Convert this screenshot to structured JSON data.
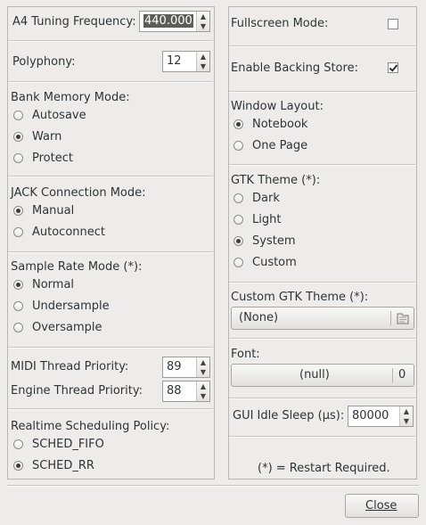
{
  "left": {
    "a4": {
      "label": "A4 Tuning Frequency:",
      "value": "440.000"
    },
    "polyphony": {
      "label": "Polyphony:",
      "value": "12"
    },
    "bank_memory": {
      "title": "Bank Memory Mode:",
      "options": [
        "Autosave",
        "Warn",
        "Protect"
      ],
      "selected": "Warn"
    },
    "jack": {
      "title": "JACK Connection Mode:",
      "options": [
        "Manual",
        "Autoconnect"
      ],
      "selected": "Manual"
    },
    "sample_rate": {
      "title": "Sample Rate Mode (*):",
      "options": [
        "Normal",
        "Undersample",
        "Oversample"
      ],
      "selected": "Normal"
    },
    "midi_priority": {
      "label": "MIDI Thread Priority:",
      "value": "89"
    },
    "engine_priority": {
      "label": "Engine Thread Priority:",
      "value": "88"
    },
    "realtime": {
      "title": "Realtime Scheduling Policy:",
      "options": [
        "SCHED_FIFO",
        "SCHED_RR"
      ],
      "selected": "SCHED_RR"
    }
  },
  "right": {
    "fullscreen": {
      "label": "Fullscreen Mode:",
      "checked": false
    },
    "backing_store": {
      "label": "Enable Backing Store:",
      "checked": true
    },
    "window_layout": {
      "title": "Window Layout:",
      "options": [
        "Notebook",
        "One Page"
      ],
      "selected": "Notebook"
    },
    "gtk_theme": {
      "title": "GTK Theme (*):",
      "options": [
        "Dark",
        "Light",
        "System",
        "Custom"
      ],
      "selected": "System"
    },
    "custom_theme": {
      "title": "Custom GTK Theme (*):",
      "value": "(None)"
    },
    "font": {
      "title": "Font:",
      "name": "(null)",
      "size": "0"
    },
    "idle_sleep": {
      "label": "GUI Idle Sleep (µs):",
      "value": "80000"
    },
    "restart_note": "(*) = Restart Required."
  },
  "footer": {
    "close_label": "Close"
  }
}
